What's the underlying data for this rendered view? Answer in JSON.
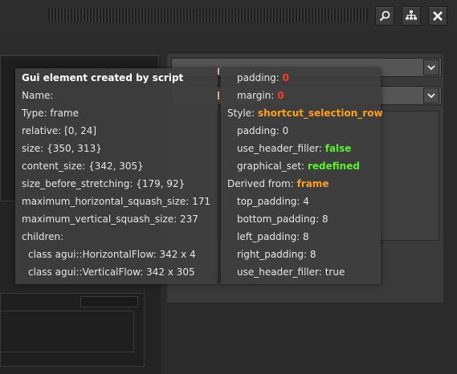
{
  "icons": {
    "search": "magnifier-icon",
    "hierarchy": "hierarchy-icon",
    "close": "close-icon",
    "dropdown": "chevron-down-icon"
  },
  "colors": {
    "value_red": "#ff3b1f",
    "value_orange": "#ff9f1c",
    "value_green": "#59f22a",
    "tooltip_bg": "#3e3e3e"
  },
  "inspector": {
    "title": "Gui element created by script",
    "name_label": "Name:",
    "type_label": "Type: frame",
    "relative_label": "relative: [0, 24]",
    "size_label": "size: {350, 313}",
    "content_size_label": "content_size: {342, 305}",
    "size_before_stretching_label": "size_before_stretching: {179, 92}",
    "max_h_squash_label": "maximum_horizontal_squash_size: 171",
    "max_v_squash_label": "maximum_vertical_squash_size: 237",
    "children_label": "children:",
    "children": [
      "class agui::HorizontalFlow: 342 x 4",
      "class agui::VerticalFlow: 342 x 305"
    ]
  },
  "style": {
    "padding_label": "padding:",
    "padding_value": "0",
    "margin_label": "margin:",
    "margin_value": "0",
    "style_label": "Style:",
    "style_name": "shortcut_selection_row",
    "inner_padding": "padding: 0",
    "use_header_filler_label": "use_header_filler:",
    "use_header_filler_value": "false",
    "graphical_set_label": "graphical_set:",
    "graphical_set_value": "redefined",
    "derived_label": "Derived from:",
    "derived_value": "frame",
    "top_padding": "top_padding: 4",
    "bottom_padding": "bottom_padding: 8",
    "left_padding": "left_padding: 8",
    "right_padding": "right_padding: 8",
    "use_header_filler_true": "use_header_filler: true"
  }
}
